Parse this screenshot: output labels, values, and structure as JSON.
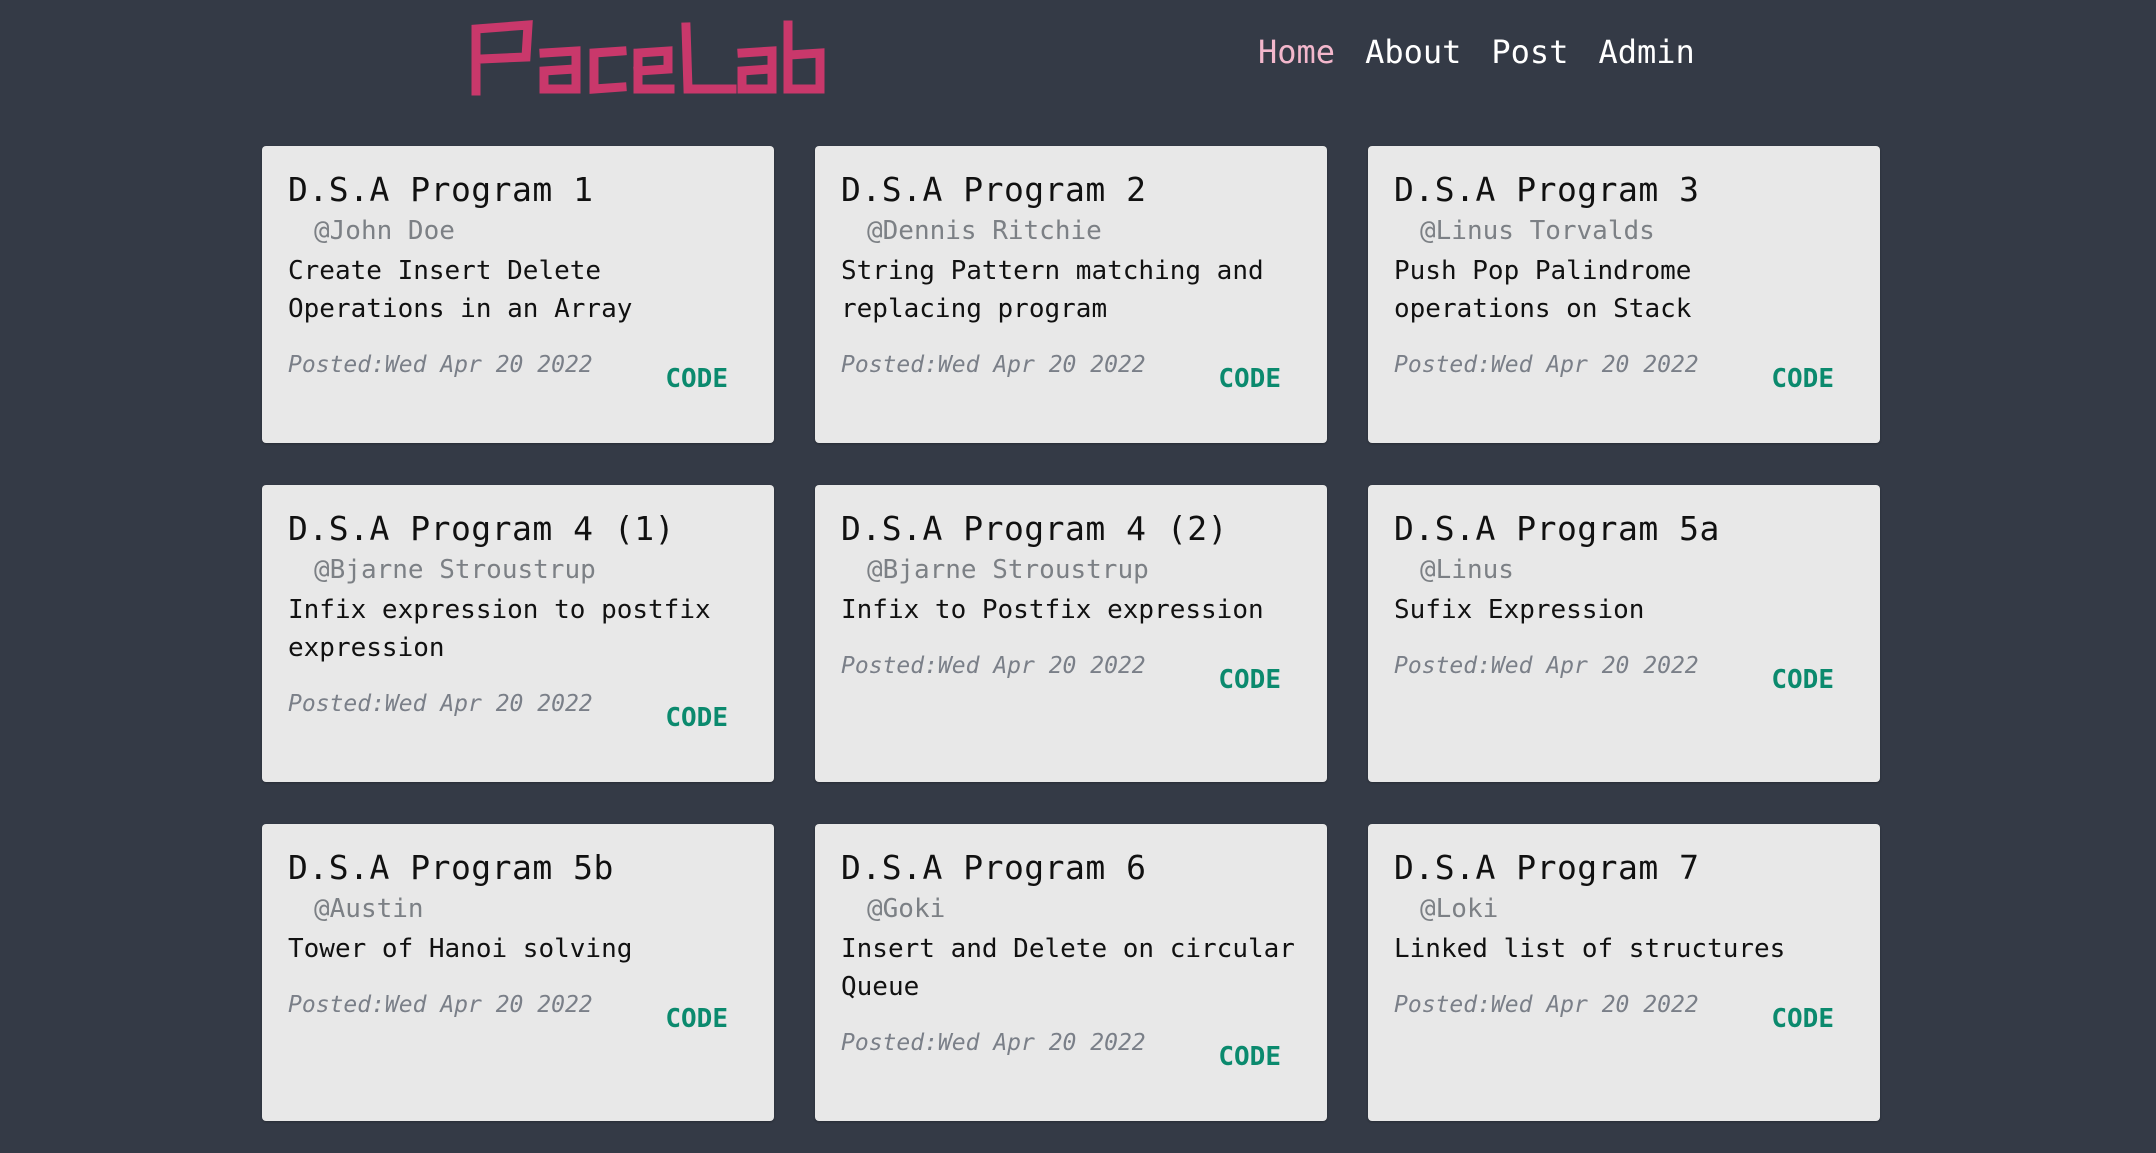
{
  "brand": {
    "logo_text": "PaceLab",
    "logo_color": "#c9386b"
  },
  "nav": {
    "items": [
      {
        "label": "Home",
        "active": true
      },
      {
        "label": "About",
        "active": false
      },
      {
        "label": "Post",
        "active": false
      },
      {
        "label": "Admin",
        "active": false
      }
    ],
    "active_color": "#f3b7cc"
  },
  "posts": [
    {
      "title": "D.S.A Program 1",
      "author": "@John Doe",
      "description": "Create Insert Delete Operations in an Array",
      "posted": "Posted:Wed Apr 20 2022",
      "link_label": "CODE"
    },
    {
      "title": "D.S.A Program 2",
      "author": "@Dennis Ritchie",
      "description": "String Pattern matching and replacing program",
      "posted": "Posted:Wed Apr 20 2022",
      "link_label": "CODE"
    },
    {
      "title": "D.S.A Program 3",
      "author": "@Linus Torvalds",
      "description": "Push Pop Palindrome operations on Stack",
      "posted": "Posted:Wed Apr 20 2022",
      "link_label": "CODE"
    },
    {
      "title": "D.S.A Program 4 (1)",
      "author": "@Bjarne Stroustrup",
      "description": "Infix expression to postfix expression",
      "posted": "Posted:Wed Apr 20 2022",
      "link_label": "CODE"
    },
    {
      "title": "D.S.A Program 4 (2)",
      "author": "@Bjarne Stroustrup",
      "description": "Infix to Postfix expression",
      "posted": "Posted:Wed Apr 20 2022",
      "link_label": "CODE"
    },
    {
      "title": "D.S.A Program 5a",
      "author": "@Linus",
      "description": "Sufix Expression",
      "posted": "Posted:Wed Apr 20 2022",
      "link_label": "CODE"
    },
    {
      "title": "D.S.A Program 5b",
      "author": "@Austin",
      "description": "Tower of Hanoi solving",
      "posted": "Posted:Wed Apr 20 2022",
      "link_label": "CODE"
    },
    {
      "title": "D.S.A Program 6",
      "author": "@Goki",
      "description": "Insert and Delete on circular Queue",
      "posted": "Posted:Wed Apr 20 2022",
      "link_label": "CODE"
    },
    {
      "title": "D.S.A Program 7",
      "author": "@Loki",
      "description": "Linked list of structures",
      "posted": "Posted:Wed Apr 20 2022",
      "link_label": "CODE"
    }
  ],
  "colors": {
    "background": "#343a46",
    "card": "#e8e8e8",
    "link": "#0b8a6e"
  }
}
